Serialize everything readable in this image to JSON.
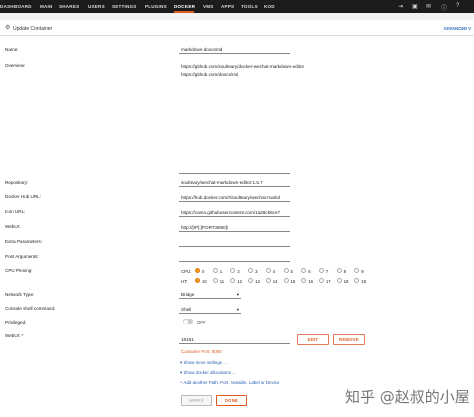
{
  "nav": {
    "items": [
      "DASHBOARD",
      "MAIN",
      "SHARES",
      "USERS",
      "SETTINGS",
      "PLUGINS",
      "DOCKER",
      "VMS",
      "APPS",
      "TOOLS",
      "KOD"
    ],
    "active": "DOCKER"
  },
  "header": {
    "title": "Update Container",
    "advanced": "ADVANCED V"
  },
  "form": {
    "name_label": "Name:",
    "name_value": "markdown-doocsmd",
    "overview_label": "Overview:",
    "overview_lines": [
      "https://github.com/soulteary/docker-wechat-markdown-editor",
      "https://github.com/doocs/md"
    ],
    "repository_label": "Repository:",
    "repository_value": "soulteary/wechat-markdown-editor:1.5.7",
    "dockerhub_label": "Docker Hub URL:",
    "dockerhub_value": "https://hub.docker.com/r/soulteary/wechat-markd",
    "icon_label": "Icon URL:",
    "icon_value": "https://camo.githubusercontent.com/1a28c56ce7",
    "webui_label": "WebUI:",
    "webui_value": "http://[IP]:[PORT:8080]/",
    "extra_label": "Extra Parameters:",
    "post_label": "Post Arguments:",
    "cpu_label": "CPU Pinning:",
    "cpu_row_label": "CPU:",
    "ht_row_label": "HT:",
    "cpu_row": [
      "0",
      "1",
      "2",
      "3",
      "4",
      "5",
      "6",
      "7",
      "8",
      "9"
    ],
    "ht_row": [
      "10",
      "11",
      "12",
      "13",
      "14",
      "15",
      "16",
      "17",
      "18",
      "19"
    ],
    "network_label": "Network Type:",
    "network_value": "Bridge",
    "console_label": "Console shell command:",
    "console_value": "Shell",
    "privileged_label": "Privileged:",
    "privileged_value": "OFF",
    "webui_port_label": "WebUI: *",
    "webui_port_value": "18181",
    "edit_label": "EDIT",
    "remove_label": "REMOVE",
    "container_port": "Container Port: 8080",
    "show_more": "Show more settings ...",
    "show_alloc": "Show docker allocations ...",
    "add_another": "Add another Path, Port, Variable, Label or Device",
    "apply_label": "APPLY",
    "done_label": "DONE"
  },
  "watermark": "知乎 @赵叔的小屋"
}
